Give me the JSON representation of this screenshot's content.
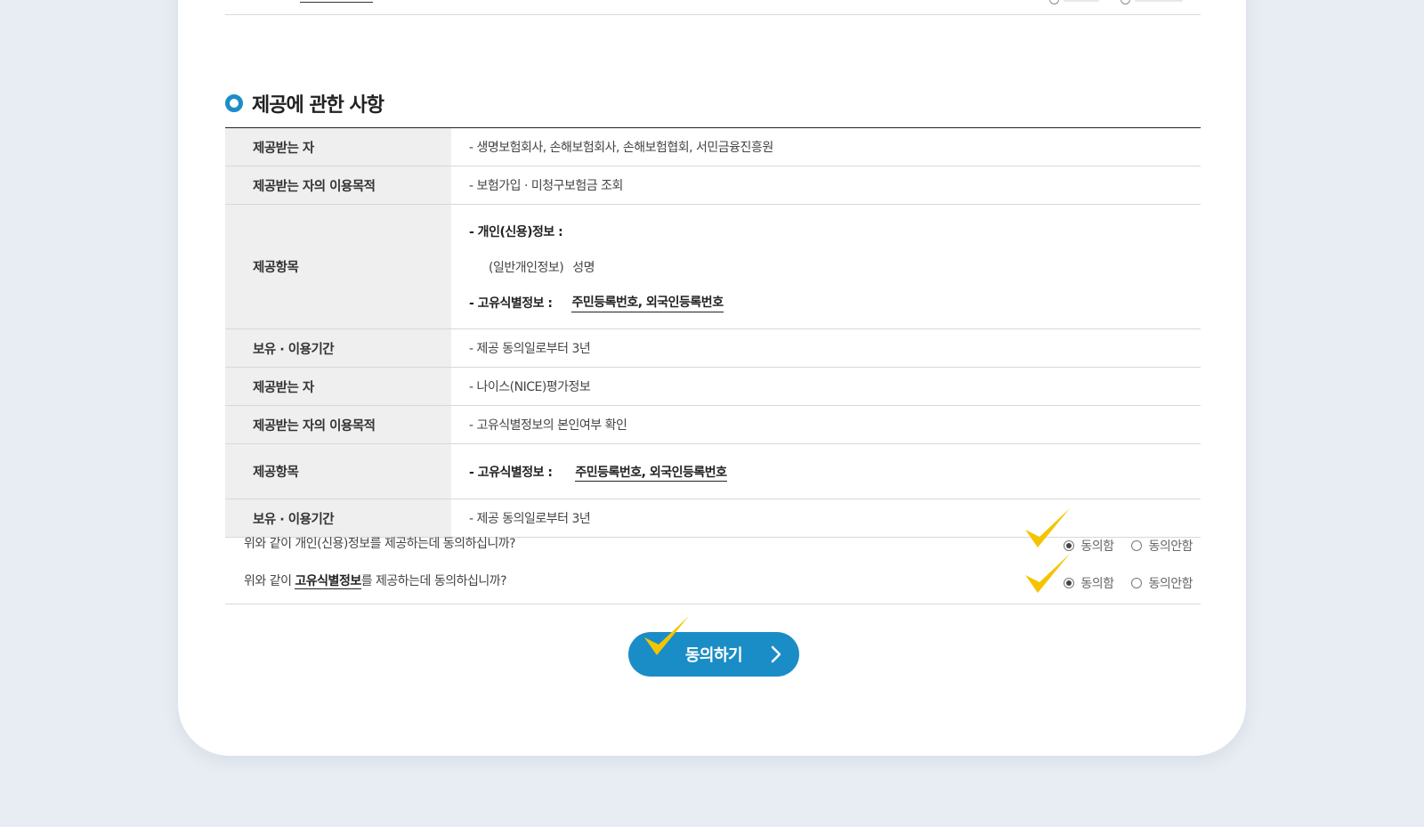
{
  "section": {
    "title": "제공에 관한 사항"
  },
  "table": {
    "group1": {
      "recipient_label": "제공받는 자",
      "recipient_value": "- 생명보험회사, 손해보험회사, 손해보험협회, 서민금융진흥원",
      "purpose_label": "제공받는 자의 이용목적",
      "purpose_value": "- 보험가입 · 미청구보험금 조회",
      "items_label": "제공항목",
      "items_personal_label": "- 개인(신용)정보 :",
      "items_general_label": "(일반개인정보)",
      "items_general_value": "성명",
      "items_unique_label": "- 고유식별정보 :",
      "items_unique_value": "주민등록번호, 외국인등록번호",
      "period_label": "보유 · 이용기간",
      "period_value": "- 제공 동의일로부터 3년"
    },
    "group2": {
      "recipient_label": "제공받는 자",
      "recipient_value": "- 나이스(NICE)평가정보",
      "purpose_label": "제공받는 자의 이용목적",
      "purpose_value": "- 고유식별정보의 본인여부 확인",
      "items_label": "제공항목",
      "items_unique_label": "- 고유식별정보 :",
      "items_unique_value": "주민등록번호, 외국인등록번호",
      "period_label": "보유 · 이용기간",
      "period_value": "- 제공 동의일로부터 3년"
    }
  },
  "consent": {
    "q1": "위와 같이 개인(신용)정보를 제공하는데 동의하십니까?",
    "q2_prefix": "위와 같이 ",
    "q2_highlight": "고유식별정보",
    "q2_suffix": "를 제공하는데 동의하십니까?",
    "agree_label": "동의함",
    "disagree_label": "동의안함",
    "q1_selected": "agree",
    "q2_selected": "agree"
  },
  "button": {
    "agree": "동의하기"
  },
  "colors": {
    "accent": "#1b8dc6",
    "check": "#f5c400",
    "background": "#e8edf3"
  }
}
